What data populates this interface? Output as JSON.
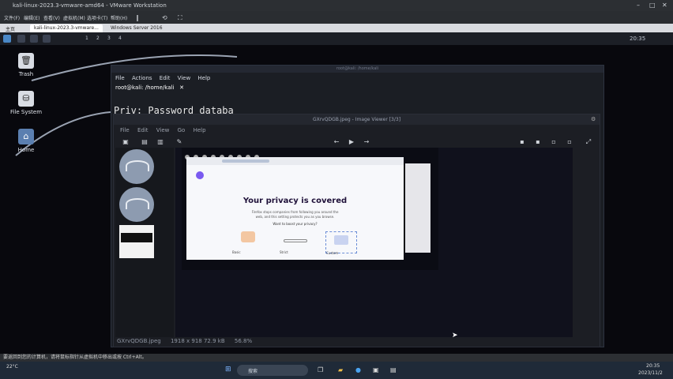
{
  "vmware": {
    "title": "kali-linux-2023.3-vmware-amd64 - VMware Workstation",
    "menu": [
      "文件(F)",
      "编辑(E)",
      "查看(V)",
      "虚拟机(M)",
      "选项卡(T)",
      "帮助(H)"
    ],
    "tabs": [
      "主页",
      "kali-linux-2023.3-vmware...",
      "Windows Server 2016"
    ]
  },
  "kali_panel": {
    "workspaces": [
      "1",
      "2",
      "3",
      "4"
    ],
    "clock": "20:35"
  },
  "desktop_icons": [
    {
      "label": "Trash",
      "icon": "trash-icon"
    },
    {
      "label": "File System",
      "icon": "drive-icon"
    },
    {
      "label": "Home",
      "icon": "home-folder-icon"
    }
  ],
  "terminal": {
    "title": "root@kali: /home/kali",
    "menu": [
      "File",
      "Actions",
      "Edit",
      "View",
      "Help"
    ],
    "tab": "root@kali: /home/kali",
    "prompt_line": "Priv: Password databa"
  },
  "viewer": {
    "title": "GXrvQDGB.jpeg - Image Viewer [3/3]",
    "menu": [
      "File",
      "Edit",
      "View",
      "Go",
      "Help"
    ],
    "status": [
      "GXrvQDGB.jpeg",
      "1918 x 918 72.9 kB",
      "56.8%"
    ]
  },
  "privacy": {
    "title": "Your privacy is covered",
    "subtitle": "Firefox stops companies from following you around the web, and this setting protects you as you browse.",
    "question": "Want to boost your privacy?",
    "options": [
      "Basic",
      "Strict",
      "Custom"
    ]
  },
  "statusbar": {
    "text": "要返回到您的计算机，请将鼠标指针从虚拟机中移出或按 Ctrl+Alt。"
  },
  "taskbar": {
    "weather": "22°C",
    "search": "搜索",
    "time": "20:35",
    "date": "2023/11/2"
  }
}
